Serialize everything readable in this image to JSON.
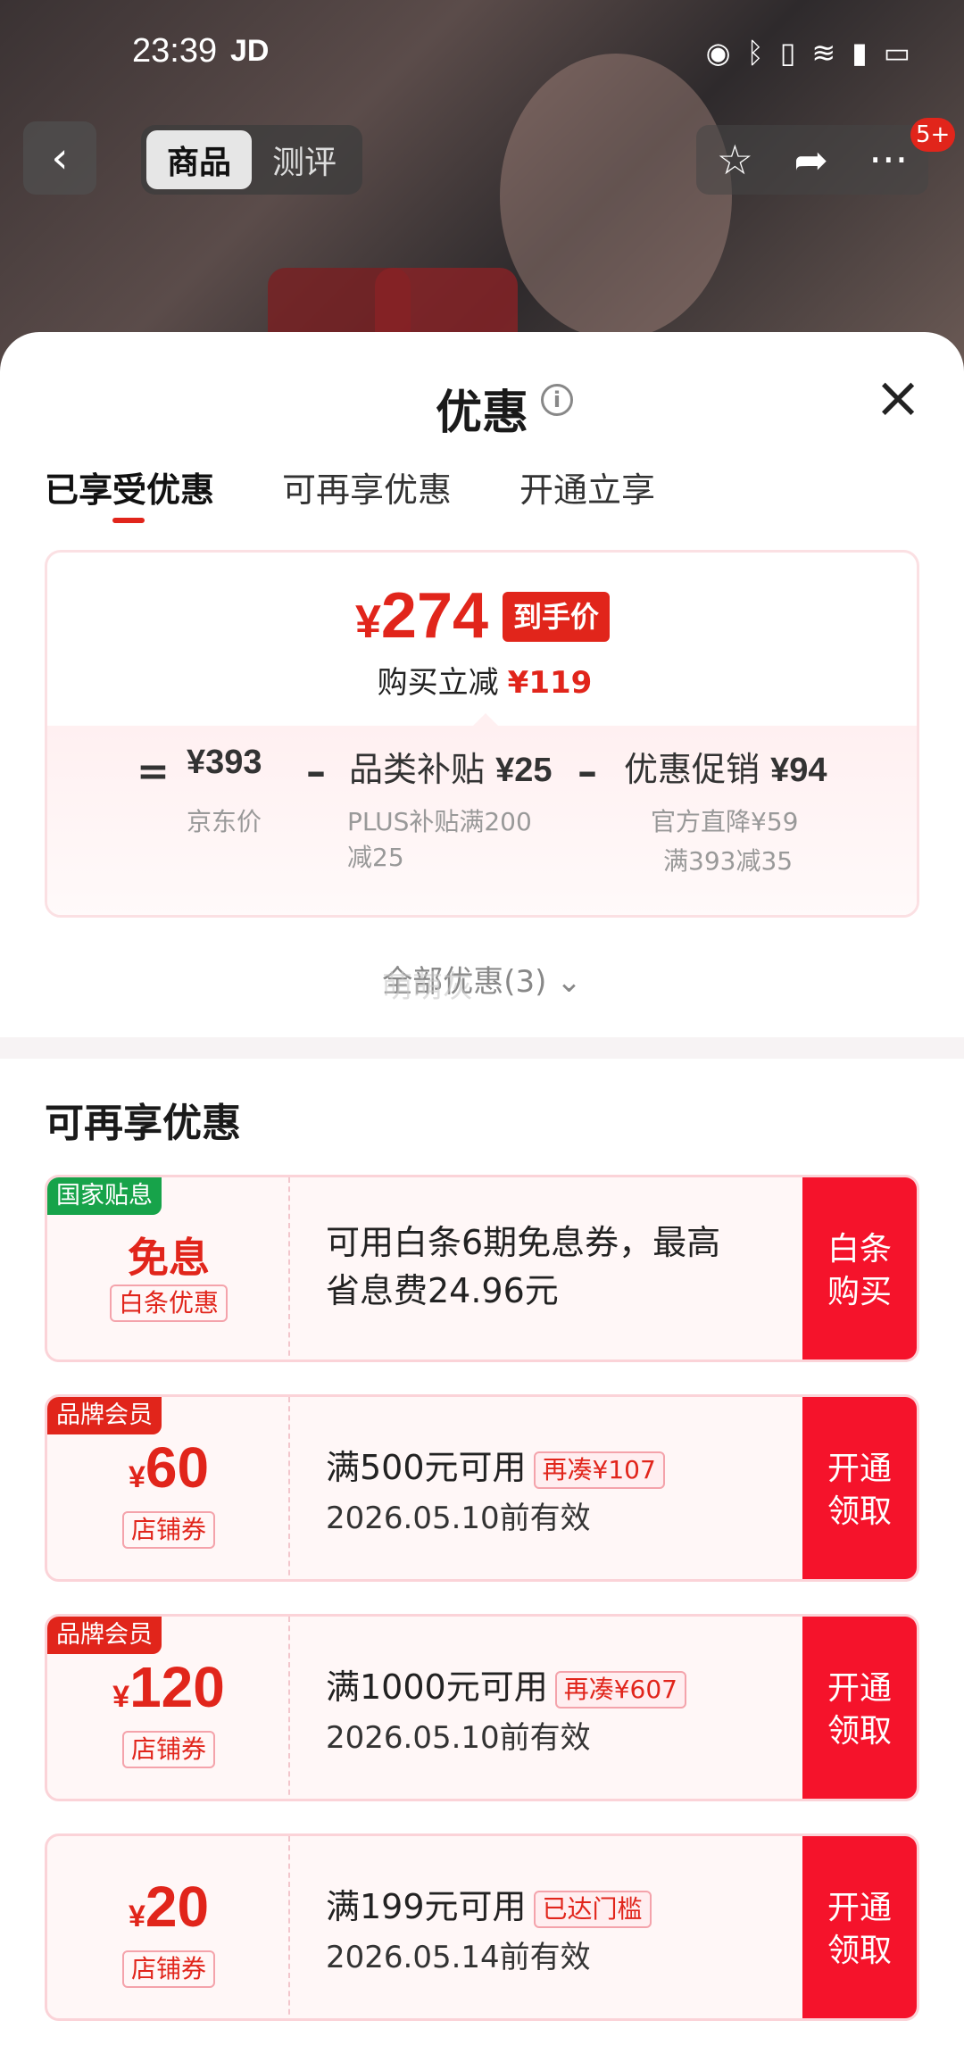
{
  "status_bar": {
    "time": "23:39",
    "app": "JD"
  },
  "nav": {
    "tabs": [
      {
        "label": "商品"
      },
      {
        "label": "测评"
      }
    ],
    "badge": "5+"
  },
  "sheet": {
    "title": "优惠",
    "segments": [
      {
        "label": "已享受优惠"
      },
      {
        "label": "可再享优惠"
      },
      {
        "label": "开通立享"
      }
    ],
    "price": {
      "currency": "¥",
      "final": "274",
      "tag": "到手价",
      "reduce_label": "购买立减",
      "reduce_value": "¥119"
    },
    "breakdown": {
      "eq": "=",
      "minus": "–",
      "jd_price": "¥393",
      "jd_label": "京东价",
      "subsidy_label": "品类补贴",
      "subsidy_value": "¥25",
      "subsidy_note_1": "PLUS补贴满200",
      "subsidy_note_2": "减25",
      "promo_label": "优惠促销",
      "promo_value": "¥94",
      "promo_note_1": "官方直降¥59",
      "promo_note_2": "满393减35"
    },
    "all_promos": "全部优惠(3)",
    "watermark": "萌萌灰",
    "section_title": "可再享优惠",
    "coupons": [
      {
        "tag": "国家贴息",
        "main": "免息",
        "kind": "白条优惠",
        "desc_1": "可用白条6期免息券，最高",
        "desc_2": "省息费24.96元",
        "action_1": "白条",
        "action_2": "购买"
      },
      {
        "tag": "品牌会员",
        "currency": "¥",
        "amount": "60",
        "kind": "店铺券",
        "cond": "满500元可用",
        "pill": "再凑¥107",
        "date": "2026.05.10前有效",
        "action_1": "开通",
        "action_2": "领取"
      },
      {
        "tag": "品牌会员",
        "currency": "¥",
        "amount": "120",
        "kind": "店铺券",
        "cond": "满1000元可用",
        "pill": "再凑¥607",
        "date": "2026.05.10前有效",
        "action_1": "开通",
        "action_2": "领取"
      },
      {
        "currency": "¥",
        "amount": "20",
        "kind": "店铺券",
        "cond": "满199元可用",
        "pill": "已达门槛",
        "date": "2026.05.14前有效",
        "action_1": "开通",
        "action_2": "领取"
      }
    ]
  },
  "colors": {
    "accent": "#e1251b",
    "coupon_action": "#f5132b",
    "tag_green": "#17a34a"
  },
  "icons": [
    "back-icon",
    "star-icon",
    "share-icon",
    "more-icon",
    "info-icon",
    "close-icon",
    "chevron-down-icon",
    "eye-icon",
    "bluetooth-icon",
    "vibrate-icon",
    "wifi-icon",
    "signal-icon",
    "battery-icon"
  ]
}
